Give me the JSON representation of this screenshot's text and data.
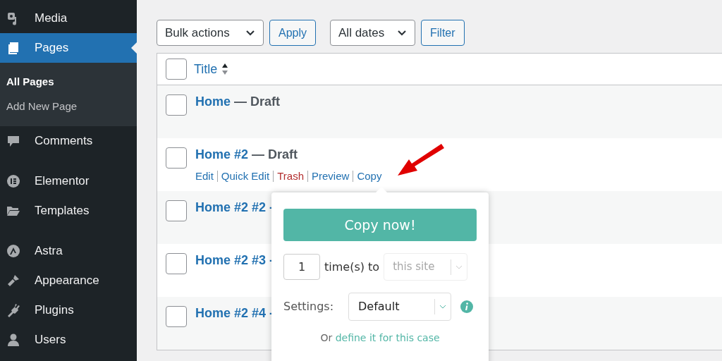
{
  "sidebar": {
    "sections": [
      [
        {
          "label": "Media",
          "selected": false
        },
        {
          "label": "Pages",
          "selected": true,
          "submenu": [
            {
              "label": "All Pages",
              "selected": true
            },
            {
              "label": "Add New Page",
              "selected": false
            }
          ]
        },
        {
          "label": "Comments",
          "selected": false
        }
      ],
      [
        {
          "label": "Elementor",
          "selected": false
        },
        {
          "label": "Templates",
          "selected": false
        }
      ],
      [
        {
          "label": "Astra",
          "selected": false
        },
        {
          "label": "Appearance",
          "selected": false
        },
        {
          "label": "Plugins",
          "selected": false
        },
        {
          "label": "Users",
          "selected": false
        }
      ]
    ]
  },
  "toolbar": {
    "bulk_actions": "Bulk actions",
    "apply": "Apply",
    "dates": "All dates",
    "filter": "Filter"
  },
  "table": {
    "column": "Title",
    "all_checked": false,
    "rows": [
      {
        "title": "Home",
        "status": "— Draft",
        "checked": false,
        "actions": []
      },
      {
        "title": "Home #2",
        "status": "— Draft",
        "checked": false,
        "actions": [
          {
            "label": "Edit",
            "kind": "link"
          },
          {
            "label": "Quick Edit",
            "kind": "link"
          },
          {
            "label": "Trash",
            "kind": "danger"
          },
          {
            "label": "Preview",
            "kind": "link"
          },
          {
            "label": "Copy",
            "kind": "link"
          }
        ]
      },
      {
        "title": "Home #2 #2 -",
        "checked": false,
        "actions": []
      },
      {
        "title": "Home #2 #3 -",
        "checked": false,
        "actions": []
      },
      {
        "title": "Home #2 #4 -",
        "checked": false,
        "actions": []
      }
    ]
  },
  "popup": {
    "button": "Copy now!",
    "times": "1",
    "times_label": "time(s) to",
    "destination": {
      "placeholder": "this site",
      "disabled": true
    },
    "settings_label": "Settings:",
    "settings_value": "Default",
    "footer_text": "Or",
    "footer_link": "define it for this case"
  }
}
